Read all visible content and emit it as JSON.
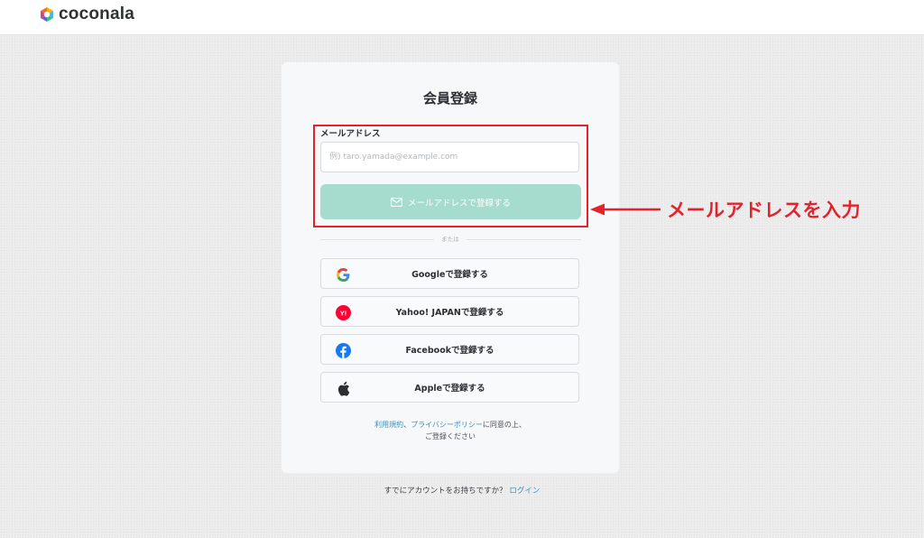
{
  "header": {
    "logo_text": "coconala"
  },
  "card": {
    "title": "会員登録",
    "email_label": "メールアドレス",
    "email_placeholder": "例) taro.yamada@example.com",
    "email_value": "",
    "email_button_label": "メールアドレスで登録する",
    "or_text": "または",
    "social_buttons": [
      {
        "label": "Googleで登録する",
        "icon": "google-icon"
      },
      {
        "label": "Yahoo! JAPANで登録する",
        "icon": "yahoo-icon"
      },
      {
        "label": "Facebookで登録する",
        "icon": "facebook-icon"
      },
      {
        "label": "Appleで登録する",
        "icon": "apple-icon"
      }
    ],
    "terms": {
      "link1": "利用規約",
      "sep": "、",
      "link2": "プライバシーポリシー",
      "suffix": "に同意の上、",
      "line2": "ご登録ください"
    }
  },
  "footer": {
    "prompt": "すでにアカウントをお持ちですか？",
    "login_link": "ログイン"
  },
  "annotation": {
    "text": "メールアドレスを入力",
    "color": "#e5212b"
  },
  "colors": {
    "primary_button": "#a5dccd",
    "link": "#3d8fb8",
    "annotation_red": "#e5212b"
  }
}
